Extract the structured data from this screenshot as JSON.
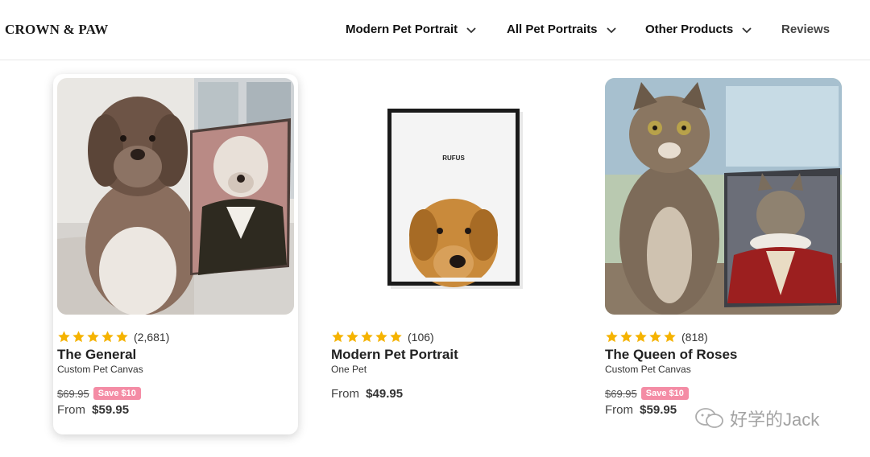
{
  "header": {
    "logo": "CROWN & PAW",
    "nav": [
      {
        "label": "Modern Pet Portrait",
        "dropdown": true
      },
      {
        "label": "All Pet Portraits",
        "dropdown": true
      },
      {
        "label": "Other Products",
        "dropdown": true
      },
      {
        "label": "Reviews",
        "dropdown": false
      }
    ]
  },
  "colors": {
    "star": "#f5b301",
    "save_badge": "#f48ca5"
  },
  "products": [
    {
      "rating_count": "(2,681)",
      "stars": 5,
      "name": "The General",
      "subtitle": "Custom Pet Canvas",
      "was_price": "$69.95",
      "save": "Save $10",
      "from_label": "From",
      "price": "$59.95"
    },
    {
      "rating_count": "(106)",
      "stars": 5,
      "name": "Modern Pet Portrait",
      "subtitle": "One Pet",
      "from_label": "From",
      "price": "$49.95",
      "frame_text": "RUFUS"
    },
    {
      "rating_count": "(818)",
      "stars": 5,
      "name": "The Queen of Roses",
      "subtitle": "Custom Pet Canvas",
      "was_price": "$69.95",
      "save": "Save $10",
      "from_label": "From",
      "price": "$59.95"
    }
  ],
  "watermark": "好学的Jack"
}
